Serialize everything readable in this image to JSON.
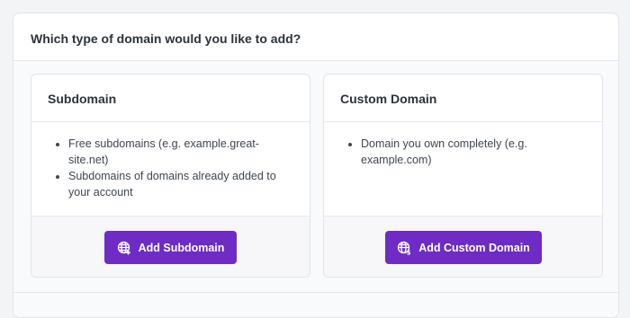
{
  "header": {
    "question": "Which type of domain would you like to add?"
  },
  "cards": [
    {
      "title": "Subdomain",
      "bullets": [
        "Free subdomains (e.g. example.great-site.net)",
        "Subdomains of domains already added to your account"
      ],
      "button_label": "Add Subdomain",
      "button_icon": "globe-plus-icon"
    },
    {
      "title": "Custom Domain",
      "bullets": [
        "Domain you own completely (e.g. example.com)"
      ],
      "button_label": "Add Custom Domain",
      "button_icon": "globe-dollar-icon"
    }
  ],
  "colors": {
    "accent": "#6f2cc4",
    "page_background": "#f3f4f6",
    "card_background": "#ffffff"
  }
}
